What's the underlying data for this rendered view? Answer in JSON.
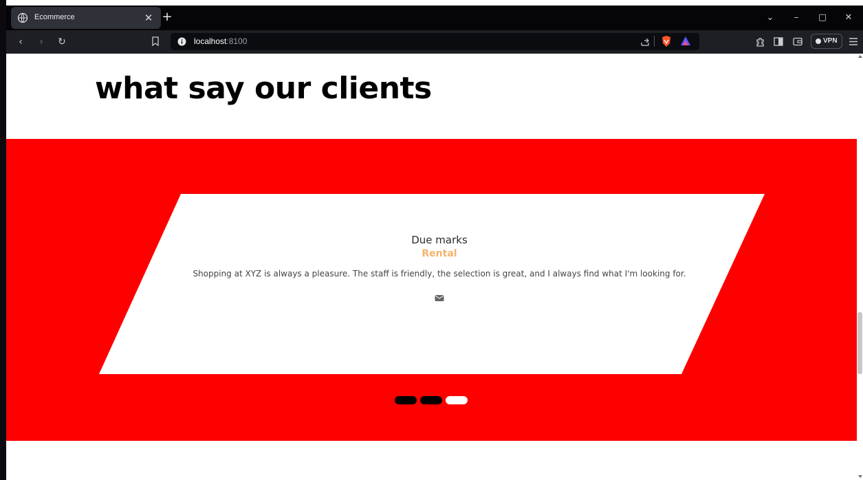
{
  "browser": {
    "tab_title": "Ecommerce",
    "url_host": "localhost",
    "url_port": ":8100",
    "vpn_label": "VPN"
  },
  "colors": {
    "band": "#ff0000",
    "accent": "#f4b36d",
    "card": "#ffffff"
  },
  "page": {
    "heading": "what say our clients"
  },
  "testimonial": {
    "name": "Due marks",
    "role": "Rental",
    "quote": "Shopping at XYZ is always a pleasure. The staff is friendly, the selection is great, and I always find what I'm looking for.",
    "icon": "envelope-icon"
  },
  "carousel": {
    "slide_count": 3,
    "active_index": 2
  }
}
